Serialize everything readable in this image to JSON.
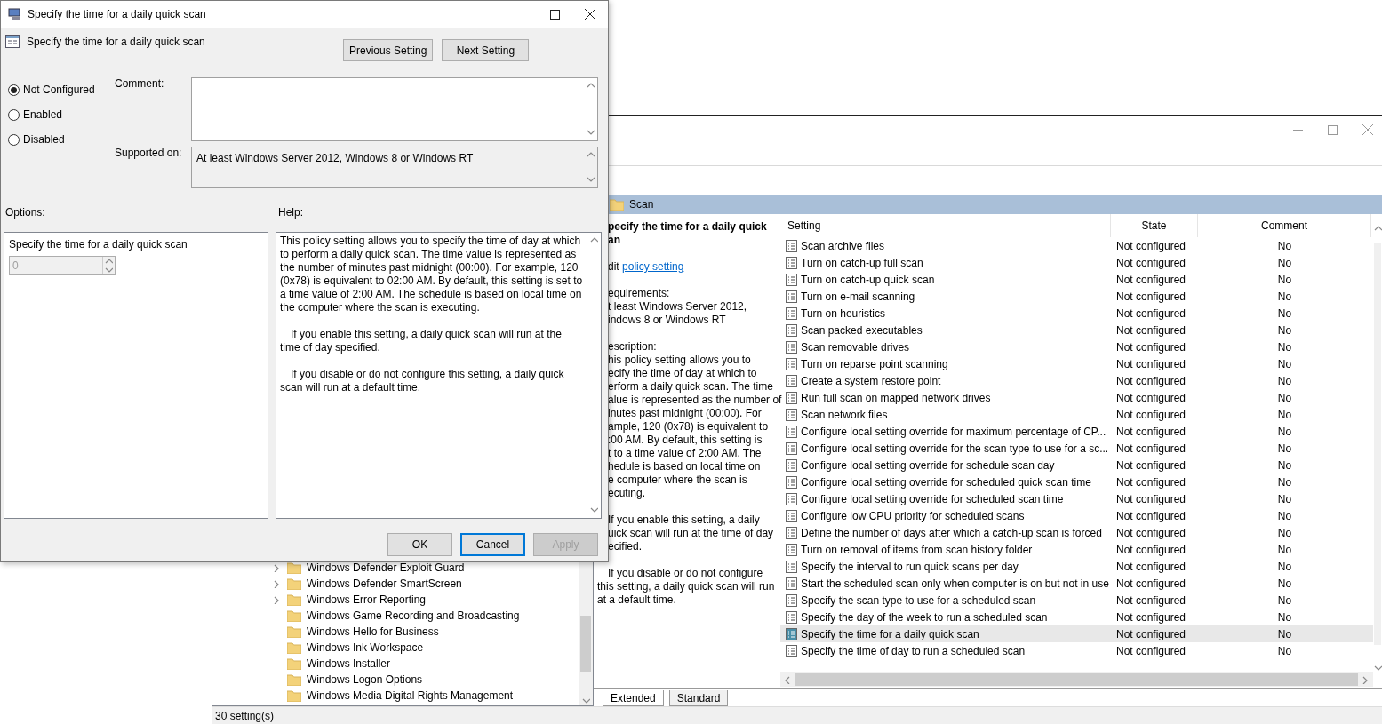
{
  "editor": {
    "tree": [
      {
        "label": "Windows Defender Exploit Guard",
        "has_children": true
      },
      {
        "label": "Windows Defender SmartScreen",
        "has_children": true
      },
      {
        "label": "Windows Error Reporting",
        "has_children": true
      },
      {
        "label": "Windows Game Recording and Broadcasting",
        "has_children": false
      },
      {
        "label": "Windows Hello for Business",
        "has_children": false
      },
      {
        "label": "Windows Ink Workspace",
        "has_children": false
      },
      {
        "label": "Windows Installer",
        "has_children": false
      },
      {
        "label": "Windows Logon Options",
        "has_children": false
      },
      {
        "label": "Windows Media Digital Rights Management",
        "has_children": false
      }
    ],
    "folder": "Scan",
    "description": {
      "title_lines": [
        "pecify the time for a daily quick",
        "an"
      ],
      "edit_prefix": "dit",
      "edit_link": "policy setting",
      "sections": [
        [
          "equirements:",
          "t least Windows Server 2012,",
          "indows 8 or Windows RT"
        ],
        [
          "escription:",
          "his policy setting allows you to",
          "ecify the time of day at which to",
          "erform a daily quick scan. The time",
          "alue is represented as the number of",
          "inutes past midnight (00:00).  For",
          "ample, 120 (0x78) is equivalent to",
          ":00 AM. By default, this setting is",
          "t to  a time value of 2:00 AM. The",
          "hedule is based on local time on",
          "e computer where the scan is",
          "ecuting."
        ],
        [
          "If you enable this setting, a daily",
          "uick scan will run at the time of day",
          "ecified."
        ]
      ],
      "closing": "If you disable or do not configure this setting, a daily quick scan will run at a default time."
    },
    "columns": [
      "Setting",
      "State",
      "Comment"
    ],
    "rows": [
      {
        "setting": "Scan archive files",
        "state": "Not configured",
        "comment": "No",
        "selected": false
      },
      {
        "setting": "Turn on catch-up full scan",
        "state": "Not configured",
        "comment": "No",
        "selected": false
      },
      {
        "setting": "Turn on catch-up quick scan",
        "state": "Not configured",
        "comment": "No",
        "selected": false
      },
      {
        "setting": "Turn on e-mail scanning",
        "state": "Not configured",
        "comment": "No",
        "selected": false
      },
      {
        "setting": "Turn on heuristics",
        "state": "Not configured",
        "comment": "No",
        "selected": false
      },
      {
        "setting": "Scan packed executables",
        "state": "Not configured",
        "comment": "No",
        "selected": false
      },
      {
        "setting": "Scan removable drives",
        "state": "Not configured",
        "comment": "No",
        "selected": false
      },
      {
        "setting": "Turn on reparse point scanning",
        "state": "Not configured",
        "comment": "No",
        "selected": false
      },
      {
        "setting": "Create a system restore point",
        "state": "Not configured",
        "comment": "No",
        "selected": false
      },
      {
        "setting": "Run full scan on mapped network drives",
        "state": "Not configured",
        "comment": "No",
        "selected": false
      },
      {
        "setting": "Scan network files",
        "state": "Not configured",
        "comment": "No",
        "selected": false
      },
      {
        "setting": "Configure local setting override for maximum percentage of CP...",
        "state": "Not configured",
        "comment": "No",
        "selected": false
      },
      {
        "setting": "Configure local setting override for the scan type to use for a sc...",
        "state": "Not configured",
        "comment": "No",
        "selected": false
      },
      {
        "setting": "Configure local setting override for schedule scan day",
        "state": "Not configured",
        "comment": "No",
        "selected": false
      },
      {
        "setting": "Configure local setting override for scheduled quick scan time",
        "state": "Not configured",
        "comment": "No",
        "selected": false
      },
      {
        "setting": "Configure local setting override for scheduled scan time",
        "state": "Not configured",
        "comment": "No",
        "selected": false
      },
      {
        "setting": "Configure low CPU priority for scheduled scans",
        "state": "Not configured",
        "comment": "No",
        "selected": false
      },
      {
        "setting": "Define the number of days after which a catch-up scan is forced",
        "state": "Not configured",
        "comment": "No",
        "selected": false
      },
      {
        "setting": "Turn on removal of items from scan history folder",
        "state": "Not configured",
        "comment": "No",
        "selected": false
      },
      {
        "setting": "Specify the interval to run quick scans per day",
        "state": "Not configured",
        "comment": "No",
        "selected": false
      },
      {
        "setting": "Start the scheduled scan only when computer is on but not in use",
        "state": "Not configured",
        "comment": "No",
        "selected": false
      },
      {
        "setting": "Specify the scan type to use for a scheduled scan",
        "state": "Not configured",
        "comment": "No",
        "selected": false
      },
      {
        "setting": "Specify the day of the week to run a scheduled scan",
        "state": "Not configured",
        "comment": "No",
        "selected": false
      },
      {
        "setting": "Specify the time for a daily quick scan",
        "state": "Not configured",
        "comment": "No",
        "selected": true
      },
      {
        "setting": "Specify the time of day to run a scheduled scan",
        "state": "Not configured",
        "comment": "No",
        "selected": false
      }
    ],
    "tabs": [
      {
        "label": "Extended",
        "selected": true
      },
      {
        "label": "Standard",
        "selected": false
      }
    ],
    "status": "30 setting(s)"
  },
  "dialog": {
    "title": "Specify the time for a daily quick scan",
    "heading": "Specify the time for a daily quick scan",
    "nav_buttons": [
      "Previous Setting",
      "Next Setting"
    ],
    "states": [
      {
        "label": "Not Configured",
        "selected": true
      },
      {
        "label": "Enabled",
        "selected": false
      },
      {
        "label": "Disabled",
        "selected": false
      }
    ],
    "comment_label": "Comment:",
    "supported_label": "Supported on:",
    "supported_value": "At least Windows Server 2012, Windows 8 or Windows RT",
    "options_label": "Options:",
    "help_label": "Help:",
    "option": {
      "label": "Specify the time for a daily quick scan",
      "value": "0",
      "disabled": true
    },
    "help": [
      "This policy setting allows you to specify the time of day at which to perform a daily quick scan. The time value is represented as the number of minutes past midnight (00:00).  For example, 120 (0x78) is equivalent to 02:00 AM. By default, this setting is set to a time value of 2:00 AM. The schedule is based on local time on the computer where the scan is executing.",
      "If you enable this setting, a daily quick scan will run at the time of day specified.",
      "If you disable or do not configure this setting, a daily quick scan will run at a default time."
    ],
    "buttons": [
      {
        "label": "OK",
        "disabled": false,
        "focused": false
      },
      {
        "label": "Cancel",
        "disabled": false,
        "focused": true
      },
      {
        "label": "Apply",
        "disabled": true,
        "focused": false
      }
    ]
  }
}
